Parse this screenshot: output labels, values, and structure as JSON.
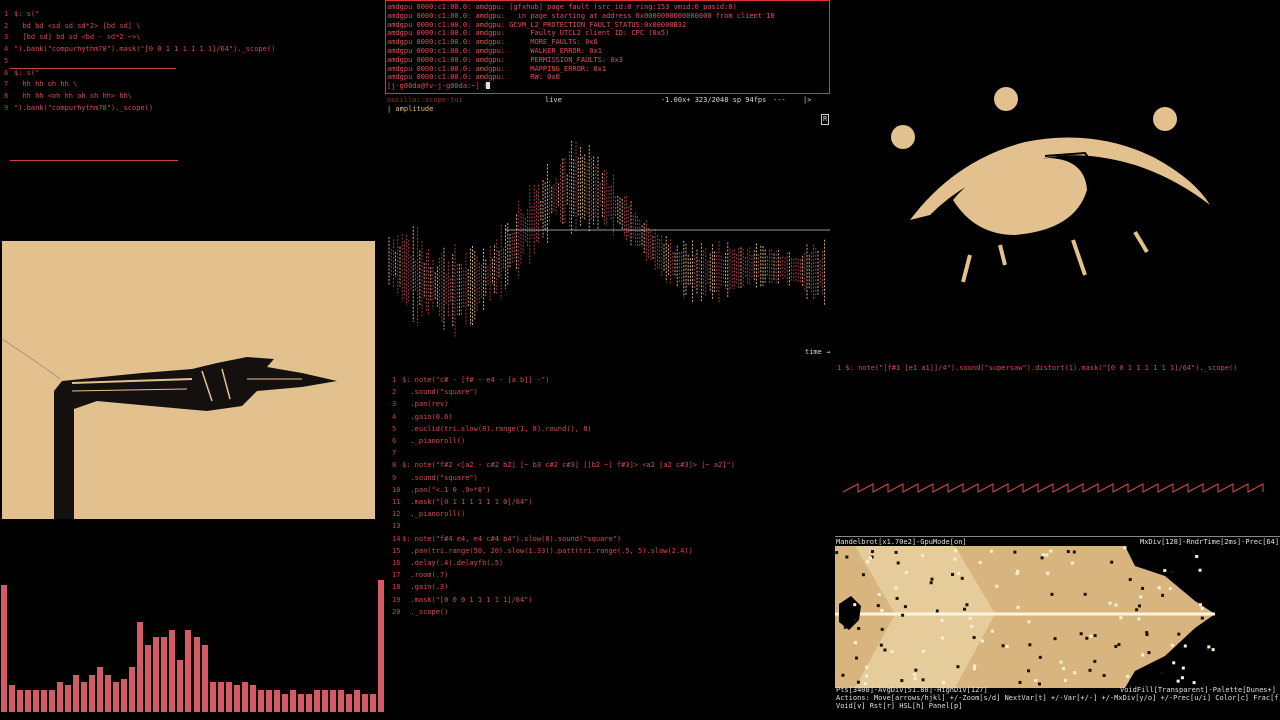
{
  "left_editor": {
    "lines": [
      {
        "n": "1",
        "t": "$: s(\""
      },
      {
        "n": "2",
        "t": "  bd bd <sd sd sd*2> [bd sd] \\"
      },
      {
        "n": "3",
        "t": "  [bd sd] bd sd <bd - sd*2 ~>\\"
      },
      {
        "n": "4",
        "t": "\").bank(\"compurhythm78\").mask(\"[0 0 1 1 1 1 1 1]/64\")._scope()"
      },
      {
        "n": "5",
        "t": ""
      },
      {
        "n": "6",
        "t": "$: s(\""
      },
      {
        "n": "7",
        "t": "  hh hh oh hh \\"
      },
      {
        "n": "8",
        "t": "  hh hh <oh hh oh oh hh> hh\\"
      },
      {
        "n": "9",
        "t": "\").bank(\"compurhythm78\")._scope()"
      }
    ]
  },
  "terminal": {
    "lines": [
      "amdgpu 0000:c1:00.0: amdgpu: [gfxhub] page fault (src_id:0 ring:153 vmid:0 pasid:0)",
      "amdgpu 0000:c1:00.0: amdgpu:   in page starting at address 0x0000000000000000 from client 10",
      "amdgpu 0000:c1:00.0: amdgpu: GCVM_L2_PROTECTION_FAULT_STATUS:0x00000B32",
      "amdgpu 0000:c1:00.0: amdgpu:      Faulty UTCL2 client ID: CPC (0x5)",
      "amdgpu 0000:c1:00.0: amdgpu:      MORE_FAULTS: 0x0",
      "amdgpu 0000:c1:00.0: amdgpu:      WALKER_ERROR: 0x1",
      "amdgpu 0000:c1:00.0: amdgpu:      PERMISSION_FAULTS: 0x3",
      "amdgpu 0000:c1:00.0: amdgpu:      MAPPING_ERROR: 0x1",
      "amdgpu 0000:c1:00.0: amdgpu:      RW: 0x0"
    ],
    "prompt": "[j-g00da@fv-j-g00da:~] $ "
  },
  "scope": {
    "title": "oscillo::scope-tui",
    "mode": "live",
    "stats": "-1.00x+ 323/2048 sp 94fps",
    "dashes": "---",
    "arrow": "|>",
    "channel": "| amplitude",
    "side_label": "R",
    "x_label": "time →"
  },
  "middle_editor": {
    "lines": [
      {
        "n": "1",
        "t": "$: note(\"c# - [f# - e4 - [a b]] -\")"
      },
      {
        "n": "2",
        "t": "  .sound(\"square\")"
      },
      {
        "n": "3",
        "t": "  .pan(rev)"
      },
      {
        "n": "4",
        "t": "  .gain(0.6)"
      },
      {
        "n": "5",
        "t": "  .euclid(tri.slow(8).range(1, 8).round(), 8)"
      },
      {
        "n": "6",
        "t": "  ._pianoroll()"
      },
      {
        "n": "7",
        "t": ""
      },
      {
        "n": "8",
        "t": "$: note(\"f#2 <[a2 - c#2 b2] [~ b3 c#2 c#3] [[b2 ~] f#3]> <a2 [a2 c#3]> [~ a2]\")"
      },
      {
        "n": "9",
        "t": "  .sound(\"square\")"
      },
      {
        "n": "10",
        "t": "  .pan(\"<.1 0 .9>*8\")"
      },
      {
        "n": "11",
        "t": "  .mask(\"[0 1 1 1 1 1 1 0]/64\")"
      },
      {
        "n": "12",
        "t": "  ._pianoroll()"
      },
      {
        "n": "13",
        "t": ""
      },
      {
        "n": "14",
        "t": "$: note(\"f#4 e4, e4 c#4 b4\").slow(8).sound(\"square\")"
      },
      {
        "n": "15",
        "t": "  .pan(tri.range(50, 20).slow(1.33)).patt(tri.range(.5, 5).slow(2.4))"
      },
      {
        "n": "16",
        "t": "  .delay(.4).delayfb(.5)"
      },
      {
        "n": "17",
        "t": "  .room(.7)"
      },
      {
        "n": "18",
        "t": "  .gain(.3)"
      },
      {
        "n": "19",
        "t": "  .mask(\"[0 0 0 1 1 1 1 1]/64\")"
      },
      {
        "n": "20",
        "t": "  ._scope()"
      }
    ]
  },
  "saw_editor": {
    "line": "1 $: note(\"[f#1 [e1 a1]]/4\").sound(\"supersaw\").distort(1).mask(\"[0 0 1 1 1 1 1 1]/64\")._scope()"
  },
  "mandelbrot": {
    "header_left": "Mandelbrot[x1.70e2]-GpuMode[on]",
    "header_right": "MxDiv[128]-RndrTime[2ms]-Prec[64]",
    "status1_left": "Pts[3408]-AvgDiv[51.88]-HighDiv[127]",
    "status1_right": "VoidFill[Transparent]-Palette[Dunes+]",
    "status2": "Actions: Move[arrows/hjkl] +/-Zoom[s/d] NextVar[t] +/-Var[+/-] +/-MxDiv[y/o] +/-Prec[u/i] Color[c] Frac[f]",
    "status3": "Void[v] Rst[r] HSL[h] Panel[p]"
  },
  "levels": [
    0.85,
    0.18,
    0.15,
    0.15,
    0.15,
    0.15,
    0.15,
    0.2,
    0.18,
    0.25,
    0.2,
    0.25,
    0.3,
    0.25,
    0.2,
    0.22,
    0.3,
    0.6,
    0.45,
    0.5,
    0.5,
    0.55,
    0.35,
    0.55,
    0.5,
    0.45,
    0.2,
    0.2,
    0.2,
    0.18,
    0.2,
    0.18,
    0.15,
    0.15,
    0.15,
    0.12,
    0.15,
    0.12,
    0.12,
    0.15,
    0.15,
    0.15,
    0.15,
    0.12,
    0.15,
    0.12,
    0.12,
    0.88
  ],
  "colors": {
    "accent": "#c8404c",
    "tan": "#e3c18f",
    "bar": "#d45a66"
  }
}
